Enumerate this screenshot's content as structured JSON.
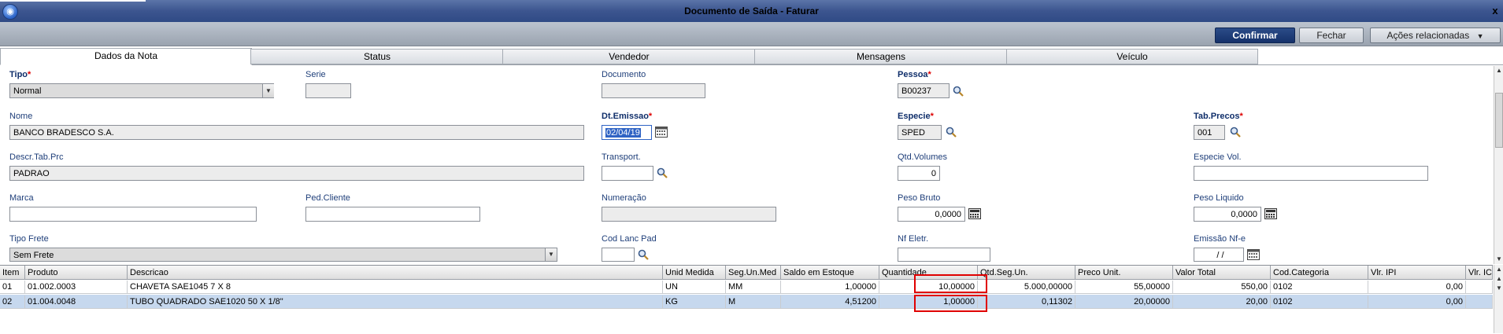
{
  "window": {
    "title": "Documento de Saída - Faturar",
    "close_glyph": "x"
  },
  "toolbar": {
    "confirm": "Confirmar",
    "close": "Fechar",
    "actions": "Ações relacionadas"
  },
  "tabs": [
    "Dados da Nota",
    "Status",
    "Vendedor",
    "Mensagens",
    "Veículo"
  ],
  "form": {
    "tipo": {
      "label": "Tipo",
      "value": "Normal"
    },
    "serie": {
      "label": "Serie",
      "value": ""
    },
    "documento": {
      "label": "Documento",
      "value": ""
    },
    "pessoa": {
      "label": "Pessoa",
      "value": "B00237"
    },
    "nome": {
      "label": "Nome",
      "value": "BANCO BRADESCO S.A."
    },
    "dt_emissao": {
      "label": "Dt.Emissao",
      "value": "02/04/19"
    },
    "especie": {
      "label": "Especie",
      "value": "SPED"
    },
    "tab_precos": {
      "label": "Tab.Precos",
      "value": "001"
    },
    "descr_tab_prc": {
      "label": "Descr.Tab.Prc",
      "value": "PADRAO"
    },
    "transport": {
      "label": "Transport.",
      "value": ""
    },
    "qtd_volumes": {
      "label": "Qtd.Volumes",
      "value": "0"
    },
    "especie_vol": {
      "label": "Especie Vol.",
      "value": ""
    },
    "marca": {
      "label": "Marca",
      "value": ""
    },
    "ped_cliente": {
      "label": "Ped.Cliente",
      "value": ""
    },
    "numeracao": {
      "label": "Numeração",
      "value": ""
    },
    "peso_bruto": {
      "label": "Peso Bruto",
      "value": "0,0000"
    },
    "peso_liquido": {
      "label": "Peso Liquido",
      "value": "0,0000"
    },
    "tipo_frete": {
      "label": "Tipo Frete",
      "value": "Sem Frete"
    },
    "cod_lanc_pad": {
      "label": "Cod Lanc Pad",
      "value": ""
    },
    "nf_eletr": {
      "label": "Nf Eletr.",
      "value": ""
    },
    "emissao_nfe": {
      "label": "Emissão Nf-e",
      "value": " / /"
    }
  },
  "grid": {
    "headers": [
      "Item",
      "Produto",
      "Descricao",
      "Unid Medida",
      "Seg.Un.Med",
      "Saldo em Estoque",
      "Quantidade",
      "Qtd.Seg.Un.",
      "Preco Unit.",
      "Valor Total",
      "Cod.Categoria",
      "Vlr. IPI",
      "Vlr. IC"
    ],
    "rows": [
      [
        "01",
        "01.002.0003",
        "CHAVETA SAE1045 7 X 8",
        "UN",
        "MM",
        "1,00000",
        "10,00000",
        "5.000,00000",
        "55,00000",
        "550,00",
        "0102",
        "0,00",
        ""
      ],
      [
        "02",
        "01.004.0048",
        "TUBO QUADRADO SAE1020 50 X 1/8\"",
        "KG",
        "M",
        "4,51200",
        "1,00000",
        "0,11302",
        "20,00000",
        "20,00",
        "0102",
        "0,00",
        ""
      ]
    ]
  },
  "colors": {
    "accent": "#15316a",
    "label": "#1f3f7a",
    "required": "#dd0000",
    "selected_row": "#c6d8ee",
    "highlight": "#e00000"
  }
}
